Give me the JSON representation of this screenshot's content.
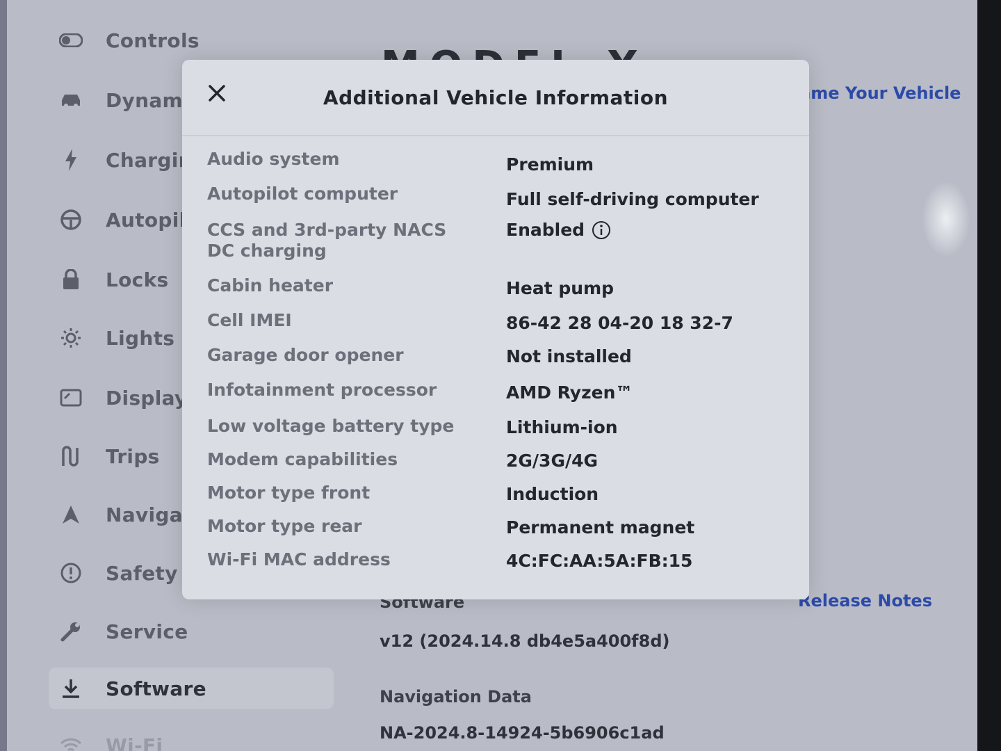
{
  "sidebar": {
    "items": [
      {
        "label": "Controls",
        "icon": "toggle-icon"
      },
      {
        "label": "Dynamics",
        "icon": "car-icon"
      },
      {
        "label": "Charging",
        "icon": "lightning-icon"
      },
      {
        "label": "Autopilot",
        "icon": "steering-wheel-icon"
      },
      {
        "label": "Locks",
        "icon": "lock-icon"
      },
      {
        "label": "Lights",
        "icon": "sun-icon"
      },
      {
        "label": "Display",
        "icon": "display-icon"
      },
      {
        "label": "Trips",
        "icon": "trips-icon"
      },
      {
        "label": "Navigation",
        "icon": "navigation-icon"
      },
      {
        "label": "Safety",
        "icon": "safety-icon"
      },
      {
        "label": "Service",
        "icon": "wrench-icon"
      },
      {
        "label": "Software",
        "icon": "download-icon",
        "active": true
      },
      {
        "label": "Wi-Fi",
        "icon": "wifi-icon"
      }
    ]
  },
  "main": {
    "model_title": "MODEL Y",
    "name_vehicle_link": "Name Your Vehicle",
    "release_notes_link": "Release Notes",
    "software_label": "Software",
    "software_version": "v12 (2024.14.8 db4e5a400f8d)",
    "navigation_data_label": "Navigation Data",
    "navigation_data_value": "NA-2024.8-14924-5b6906c1ad"
  },
  "modal": {
    "title": "Additional Vehicle Information",
    "rows": [
      {
        "key": "Audio system",
        "value": "Premium"
      },
      {
        "key": "Autopilot computer",
        "value": "Full self-driving computer"
      },
      {
        "key": "CCS and 3rd-party NACS DC charging",
        "value": "Enabled",
        "info": true
      },
      {
        "key": "Cabin heater",
        "value": "Heat pump"
      },
      {
        "key": "Cell IMEI",
        "value": "86-42 28 04-20 18 32-7"
      },
      {
        "key": "Garage door opener",
        "value": "Not installed"
      },
      {
        "key": "Infotainment processor",
        "value": "AMD Ryzen™"
      },
      {
        "key": "Low voltage battery type",
        "value": "Lithium-ion"
      },
      {
        "key": "Modem capabilities",
        "value": "2G/3G/4G"
      },
      {
        "key": "Motor type front",
        "value": "Induction"
      },
      {
        "key": "Motor type rear",
        "value": "Permanent magnet"
      },
      {
        "key": "Wi-Fi MAC address",
        "value": "4C:FC:AA:5A:FB:15"
      }
    ]
  },
  "colors": {
    "screen_bg": "#b9bcc6",
    "modal_bg": "#dadde3",
    "link": "#2d4aa8",
    "text_primary": "#24262d",
    "text_secondary": "#6d707a"
  }
}
